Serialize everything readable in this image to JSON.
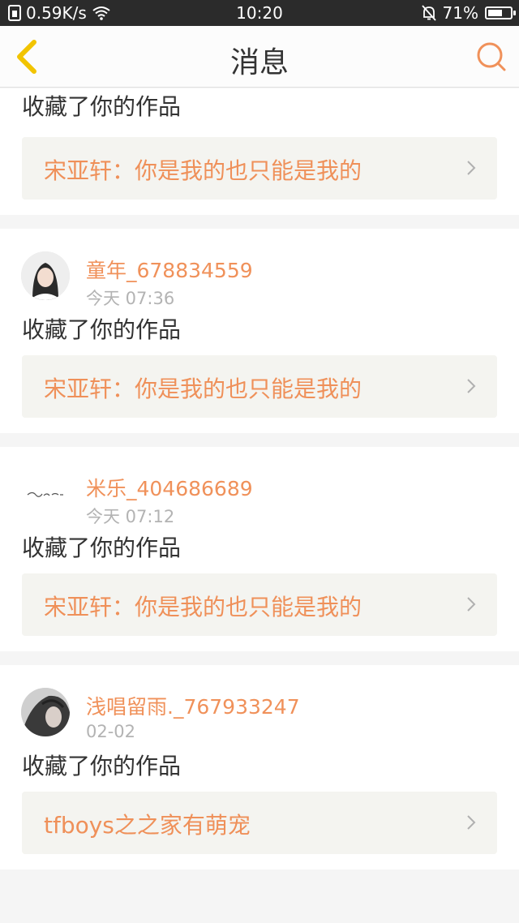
{
  "status_bar": {
    "speed": "0.59K/s",
    "time": "10:20",
    "battery": "71%",
    "battery_level": 0.71,
    "icons": [
      "sim-icon",
      "wifi-icon",
      "bell-off-icon",
      "battery-icon"
    ]
  },
  "header": {
    "title": "消息",
    "back_icon": "chevron-left-icon",
    "search_icon": "search-icon"
  },
  "colors": {
    "accent": "#f0915a",
    "back_arrow": "#f2c400",
    "box_bg": "#f4f4f0"
  },
  "messages": [
    {
      "action": "收藏了你的作品",
      "work": "宋亚轩：你是我的也只能是我的"
    },
    {
      "user": "童年_678834559",
      "time": "今天 07:36",
      "action": "收藏了你的作品",
      "work": "宋亚轩：你是我的也只能是我的"
    },
    {
      "user": "米乐_404686689",
      "time": "今天 07:12",
      "action": "收藏了你的作品",
      "work": "宋亚轩：你是我的也只能是我的"
    },
    {
      "user": "浅唱留雨._767933247",
      "time": "02-02",
      "action": "收藏了你的作品",
      "work": "tfboys之之家有萌宠"
    }
  ]
}
